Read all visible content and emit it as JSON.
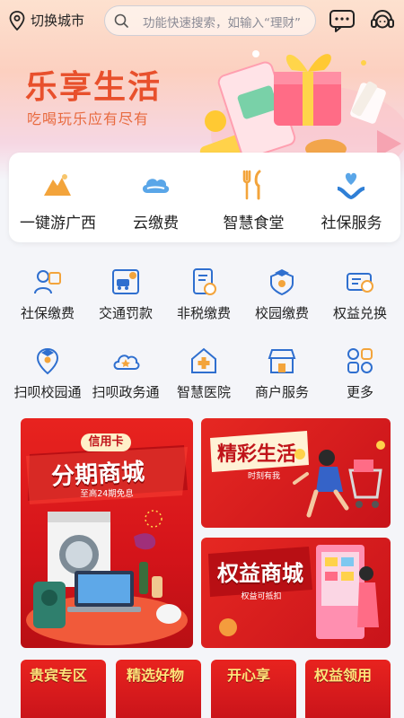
{
  "header": {
    "location_label": "切换城市",
    "search_placeholder": "功能快速搜索，如输入“理财”"
  },
  "hero": {
    "title": "乐享生活",
    "subtitle": "吃喝玩乐应有尽有"
  },
  "quick_services": [
    {
      "label": "一键游广西",
      "icon": "mountain-icon"
    },
    {
      "label": "云缴费",
      "icon": "cloud-icon"
    },
    {
      "label": "智慧食堂",
      "icon": "fork-knife-icon"
    },
    {
      "label": "社保服务",
      "icon": "hands-heart-icon"
    }
  ],
  "services_row1": [
    {
      "label": "社保缴费",
      "icon": "social-security-icon"
    },
    {
      "label": "交通罚款",
      "icon": "traffic-fine-icon"
    },
    {
      "label": "非税缴费",
      "icon": "tax-document-icon"
    },
    {
      "label": "校园缴费",
      "icon": "campus-shield-icon"
    },
    {
      "label": "权益兑换",
      "icon": "coupon-icon"
    }
  ],
  "services_row2": [
    {
      "label": "扫呗校园通",
      "icon": "campus-pin-icon"
    },
    {
      "label": "扫呗政务通",
      "icon": "gov-cloud-icon"
    },
    {
      "label": "智慧医院",
      "icon": "hospital-icon"
    },
    {
      "label": "商户服务",
      "icon": "shop-icon"
    },
    {
      "label": "更多",
      "icon": "more-grid-icon"
    }
  ],
  "banners": {
    "installment": {
      "tag": "信用卡",
      "title": "分期商城",
      "note": "至高24期免息"
    },
    "lifestyle": {
      "title": "精彩生活",
      "note": "时刻有我"
    },
    "rights": {
      "title": "权益商城",
      "note": "权益可抵扣"
    },
    "small": [
      {
        "title": "贵宾专区"
      },
      {
        "title": "精选好物"
      },
      {
        "title": "开心享"
      },
      {
        "title": "权益领用"
      }
    ]
  },
  "colors": {
    "accent": "#e8502c",
    "brand_blue": "#2f6fcf",
    "banner_red": "#d4141a",
    "gold": "#f3a43b"
  }
}
